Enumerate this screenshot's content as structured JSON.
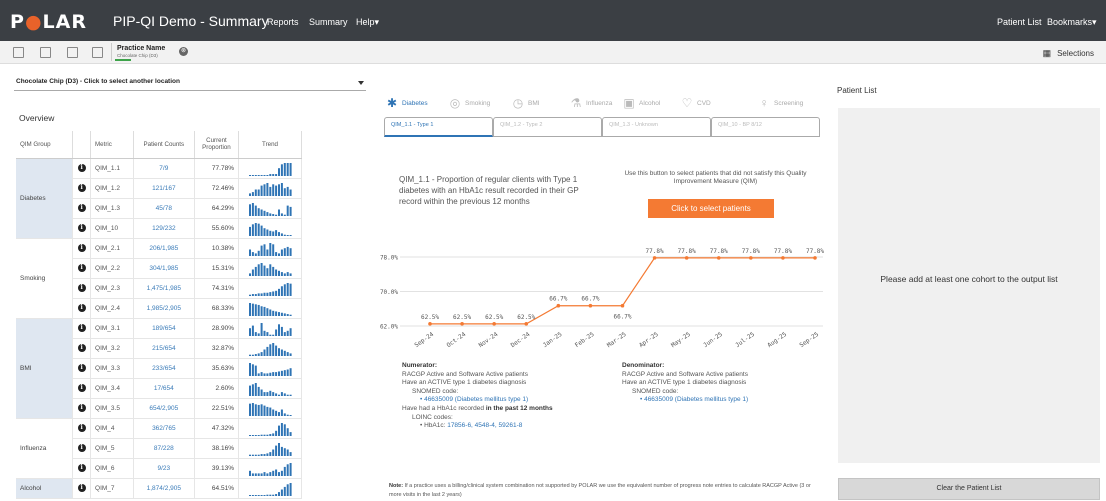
{
  "app": {
    "logo_left": "P",
    "logo_o": "●",
    "logo_right": "LAR",
    "title": "PIP-QI Demo - Summary",
    "menu": [
      "Reports",
      "Summary",
      "Help▾"
    ],
    "menu_right": [
      "Patient List",
      "Bookmarks▾"
    ]
  },
  "toolbar": {
    "practice_label": "Practice Name",
    "practice_value": "Chocolate Chip (D3)",
    "clear_x": "⊗",
    "selections_label": "Selections"
  },
  "location": {
    "label": "Chocolate Chip (D3) - Click to select another location"
  },
  "overview": {
    "title": "Overview",
    "headers": [
      "QIM Group",
      "",
      "Metric",
      "Patient Counts",
      "Current Proportion",
      "Trend"
    ],
    "info_glyph": "i",
    "groups": [
      {
        "name": "Diabetes",
        "shaded": true,
        "rows": [
          {
            "metric": "QIM_1.1",
            "counts": "7/9",
            "prop": "77.78%",
            "trend": [
              0,
              0,
              0,
              0,
              0,
              0,
              0,
              0.15,
              0.15,
              0.15,
              0.6,
              0.9,
              1,
              1,
              1
            ]
          },
          {
            "metric": "QIM_1.2",
            "counts": "121/167",
            "prop": "72.46%",
            "trend": [
              0.2,
              0.3,
              0.5,
              0.5,
              0.8,
              0.9,
              1,
              0.7,
              0.9,
              0.8,
              0.9,
              1,
              0.6,
              0.7,
              0.5
            ]
          },
          {
            "metric": "QIM_1.3",
            "counts": "45/78",
            "prop": "64.29%",
            "trend": [
              0.9,
              1,
              0.8,
              0.6,
              0.5,
              0.4,
              0.3,
              0.2,
              0.15,
              0.1,
              0.5,
              0.2,
              0.1,
              0.8,
              0.7
            ]
          },
          {
            "metric": "QIM_10",
            "counts": "129/232",
            "prop": "55.60%",
            "trend": [
              0.7,
              0.9,
              1,
              0.95,
              0.8,
              0.6,
              0.5,
              0.4,
              0.35,
              0.45,
              0.3,
              0.2,
              0.1,
              0.05,
              0.05
            ]
          }
        ]
      },
      {
        "name": "Smoking",
        "shaded": false,
        "rows": [
          {
            "metric": "QIM_2.1",
            "counts": "206/1,985",
            "prop": "10.38%",
            "trend": [
              0.5,
              0.3,
              0.2,
              0.4,
              0.8,
              0.9,
              0.5,
              1,
              0.9,
              0.3,
              0.2,
              0.5,
              0.6,
              0.7,
              0.6
            ]
          },
          {
            "metric": "QIM_2.2",
            "counts": "304/1,985",
            "prop": "15.31%",
            "trend": [
              0.2,
              0.5,
              0.7,
              0.9,
              1,
              0.8,
              0.6,
              0.9,
              0.7,
              0.5,
              0.4,
              0.3,
              0.2,
              0.3,
              0.2
            ]
          },
          {
            "metric": "QIM_2.3",
            "counts": "1,475/1,985",
            "prop": "74.31%",
            "trend": [
              0.1,
              0.15,
              0.15,
              0.2,
              0.2,
              0.25,
              0.25,
              0.3,
              0.35,
              0.4,
              0.55,
              0.75,
              0.9,
              1,
              0.95
            ]
          },
          {
            "metric": "QIM_2.4",
            "counts": "1,985/2,905",
            "prop": "68.33%",
            "trend": [
              1,
              0.95,
              0.9,
              0.85,
              0.75,
              0.7,
              0.6,
              0.5,
              0.4,
              0.35,
              0.3,
              0.25,
              0.2,
              0.15,
              0.1
            ]
          }
        ]
      },
      {
        "name": "BMI",
        "shaded": true,
        "rows": [
          {
            "metric": "QIM_3.1",
            "counts": "189/654",
            "prop": "28.90%",
            "trend": [
              0.6,
              0.8,
              0.3,
              0.2,
              1,
              0.4,
              0.3,
              0.1,
              0.1,
              0.5,
              0.9,
              0.7,
              0.3,
              0.4,
              0.6
            ]
          },
          {
            "metric": "QIM_3.2",
            "counts": "215/654",
            "prop": "32.87%",
            "trend": [
              0.1,
              0.1,
              0.15,
              0.2,
              0.3,
              0.5,
              0.7,
              0.9,
              1,
              0.8,
              0.6,
              0.5,
              0.4,
              0.3,
              0.2
            ]
          },
          {
            "metric": "QIM_3.3",
            "counts": "233/654",
            "prop": "35.63%",
            "trend": [
              1,
              0.9,
              0.8,
              0.2,
              0.3,
              0.2,
              0.2,
              0.25,
              0.3,
              0.3,
              0.35,
              0.4,
              0.45,
              0.5,
              0.6
            ]
          },
          {
            "metric": "QIM_3.4",
            "counts": "17/654",
            "prop": "2.60%",
            "trend": [
              0.8,
              0.9,
              1,
              0.7,
              0.5,
              0.3,
              0.3,
              0.4,
              0.3,
              0.2,
              0.1,
              0.3,
              0.2,
              0.1,
              0.1
            ]
          },
          {
            "metric": "QIM_3.5",
            "counts": "654/2,905",
            "prop": "22.51%",
            "trend": [
              0.95,
              1,
              0.9,
              0.85,
              0.9,
              0.8,
              0.7,
              0.65,
              0.5,
              0.4,
              0.3,
              0.5,
              0.2,
              0.1,
              0.05
            ]
          }
        ]
      },
      {
        "name": "Influenza",
        "shaded": false,
        "rows": [
          {
            "metric": "QIM_4",
            "counts": "362/765",
            "prop": "47.32%",
            "trend": [
              0.05,
              0.05,
              0.05,
              0.05,
              0.1,
              0.1,
              0.1,
              0.15,
              0.2,
              0.4,
              0.8,
              1,
              0.9,
              0.6,
              0.3
            ]
          },
          {
            "metric": "QIM_5",
            "counts": "87/228",
            "prop": "38.16%",
            "trend": [
              0.1,
              0.1,
              0.1,
              0.1,
              0.15,
              0.15,
              0.2,
              0.3,
              0.5,
              0.8,
              1,
              0.7,
              0.6,
              0.5,
              0.3
            ]
          },
          {
            "metric": "QIM_6",
            "counts": "9/23",
            "prop": "39.13%",
            "trend": [
              0.4,
              0.2,
              0.2,
              0.2,
              0.2,
              0.3,
              0.2,
              0.3,
              0.4,
              0.5,
              0.3,
              0.4,
              0.7,
              0.9,
              1
            ]
          }
        ]
      },
      {
        "name": "Alcohol",
        "shaded": true,
        "rows": [
          {
            "metric": "QIM_7",
            "counts": "1,874/2,905",
            "prop": "64.51%",
            "trend": [
              0.05,
              0.05,
              0.05,
              0.05,
              0.05,
              0.05,
              0.1,
              0.1,
              0.1,
              0.15,
              0.3,
              0.5,
              0.7,
              0.9,
              1
            ]
          }
        ]
      }
    ]
  },
  "tabs": [
    {
      "label": "Diabetes",
      "icon": "✱",
      "icon_name": "asterisk-icon",
      "active": true
    },
    {
      "label": "Smoking",
      "icon": "◎",
      "icon_name": "smoking-icon",
      "active": false
    },
    {
      "label": "BMI",
      "icon": "◷",
      "icon_name": "gauge-icon",
      "active": false
    },
    {
      "label": "Influenza",
      "icon": "⚗",
      "icon_name": "flask-icon",
      "active": false
    },
    {
      "label": "Alcohol",
      "icon": "▣",
      "icon_name": "glass-icon",
      "active": false
    },
    {
      "label": "CVD",
      "icon": "♡",
      "icon_name": "heart-icon",
      "active": false
    },
    {
      "label": "Screening",
      "icon": "♀",
      "icon_name": "screening-icon",
      "active": false
    }
  ],
  "subtabs": [
    {
      "label": "QIM_1.1 - Type 1",
      "active": true
    },
    {
      "label": "QIM_1.2 - Type 2",
      "active": false
    },
    {
      "label": "QIM_1.3 - Unknown",
      "active": false
    },
    {
      "label": "QIM_10 - BP 8/12",
      "active": false
    }
  ],
  "measure": {
    "description": "QIM_1.1 - Proportion of regular clients with Type 1 diabetes with an HbA1c result recorded in their GP record within the previous 12 months",
    "button_hint": "Use this button to select patients that did not satisfy this Quality Improvement Measure (QIM)",
    "button_label": "Click to select patients"
  },
  "chart_data": {
    "type": "line",
    "categories": [
      "Sep-24",
      "Oct-24",
      "Nov-24",
      "Dec-24",
      "Jan-25",
      "Feb-25",
      "Mar-25",
      "Apr-25",
      "May-25",
      "Jun-25",
      "Jul-25",
      "Aug-25",
      "Sep-25"
    ],
    "values": [
      62.5,
      62.5,
      62.5,
      62.5,
      66.7,
      66.7,
      66.7,
      77.8,
      77.8,
      77.8,
      77.8,
      77.8,
      77.8
    ],
    "data_labels": [
      "62.5%",
      "62.5%",
      "62.5%",
      "62.5%",
      "66.7%",
      "66.7%",
      "66.7%",
      "77.8%",
      "77.8%",
      "77.8%",
      "77.8%",
      "77.8%",
      "77.8%"
    ],
    "label_values": [
      62.5,
      62.5,
      62.5,
      62.5,
      66.7,
      66.7,
      66.7,
      77.8,
      77.8,
      77.8,
      77.8,
      77.8,
      77.8
    ],
    "y_ticks": [
      "78.0%",
      "70.0%",
      "62.0%"
    ],
    "y_tick_values": [
      78,
      70,
      62
    ],
    "ylim": [
      62,
      78
    ],
    "color": "#f47a33",
    "grid": true
  },
  "numerator": {
    "title": "Numerator:",
    "lines": [
      "RACGP Active and Software Active patients",
      "Have an ACTIVE type 1 diabetes diagnosis"
    ],
    "snomed_label": "SNOMED code:",
    "snomed_value": "• 46635009 (Diabetes mellitus type 1)",
    "hba1c_prefix": "Have had a HbA1c recorded ",
    "hba1c_bold": "in the past 12 months",
    "loinc_label": "LOINC codes:",
    "loinc_prefix": "• HbA1c: ",
    "loinc_value": "17856-6, 4548-4, 59261-8"
  },
  "denominator": {
    "title": "Denominator:",
    "lines": [
      "RACGP Active and Software Active patients",
      "Have an ACTIVE type 1 diabetes diagnosis"
    ],
    "snomed_label": "SNOMED code:",
    "snomed_value": "• 46635009 (Diabetes mellitus type 1)"
  },
  "note": {
    "bold": "Note:",
    "text": " If a practice uses a billing/clinical system combination not supported by POLAR we use the equivalent number of progress note entries to calculate RACGP Active (3 or more visits in the last 2 years)"
  },
  "patient_list": {
    "title": "Patient List",
    "empty_message": "Please add at least one cohort to the output list",
    "clear_button": "Clear the Patient List"
  }
}
